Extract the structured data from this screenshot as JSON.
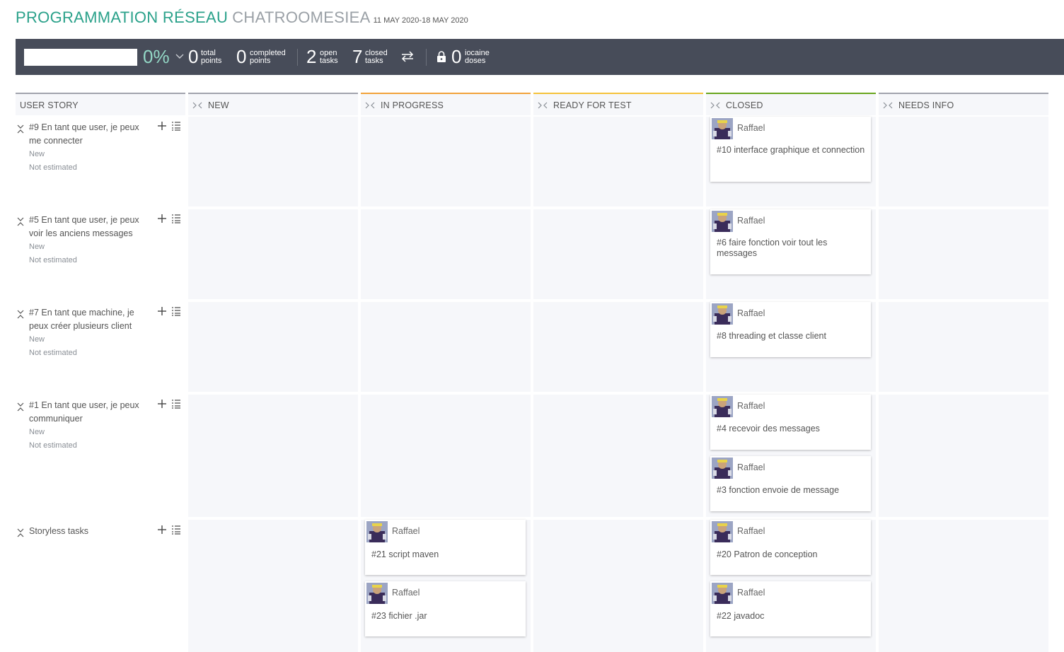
{
  "header": {
    "project": "PROGRAMMATION RÉSEAU",
    "sprint": "CHATROOMESIEA",
    "dates": "11 MAY 2020-18 MAY 2020"
  },
  "stats": {
    "percent": "0%",
    "total_points": {
      "num": "0",
      "label1": "total",
      "label2": "points"
    },
    "completed_points": {
      "num": "0",
      "label1": "completed",
      "label2": "points"
    },
    "open_tasks": {
      "num": "2",
      "label1": "open",
      "label2": "tasks"
    },
    "closed_tasks": {
      "num": "7",
      "label1": "closed",
      "label2": "tasks"
    },
    "iocaine": {
      "num": "0",
      "label1": "iocaine",
      "label2": "doses"
    }
  },
  "columns": {
    "user_story": "USER STORY",
    "new": "NEW",
    "in_progress": "IN PROGRESS",
    "ready_for_test": "READY FOR TEST",
    "closed": "CLOSED",
    "needs_info": "NEEDS INFO"
  },
  "colors": {
    "accent": "#2aa18a",
    "in_progress": "#f2a23a",
    "ready_for_test": "#f5c23b",
    "closed": "#69a51e",
    "neutral": "#a1a3ad"
  },
  "stories": [
    {
      "title": "#9 En tant que user, je peux me connecter",
      "status": "New",
      "estimate": "Not estimated"
    },
    {
      "title": "#5 En tant que user, je peux voir les anciens messages",
      "status": "New",
      "estimate": "Not estimated"
    },
    {
      "title": "#7 En tant que machine, je peux créer plusieurs client",
      "status": "New",
      "estimate": "Not estimated"
    },
    {
      "title": "#1 En tant que user, je peux communiquer",
      "status": "New",
      "estimate": "Not estimated"
    },
    {
      "title": "Storyless tasks"
    }
  ],
  "tasks": [
    {
      "owner": "Raffael",
      "title": "#10 interface graphique et connection"
    },
    {
      "owner": "Raffael",
      "title": "#6 faire fonction voir tout les messages"
    },
    {
      "owner": "Raffael",
      "title": "#8 threading et classe client"
    },
    {
      "owner": "Raffael",
      "title": "#4 recevoir des messages"
    },
    {
      "owner": "Raffael",
      "title": "#3 fonction envoie de message"
    },
    {
      "owner": "Raffael",
      "title": "#21 script maven"
    },
    {
      "owner": "Raffael",
      "title": "#23 fichier .jar"
    },
    {
      "owner": "Raffael",
      "title": "#20 Patron de conception"
    },
    {
      "owner": "Raffael",
      "title": "#22 javadoc"
    }
  ]
}
